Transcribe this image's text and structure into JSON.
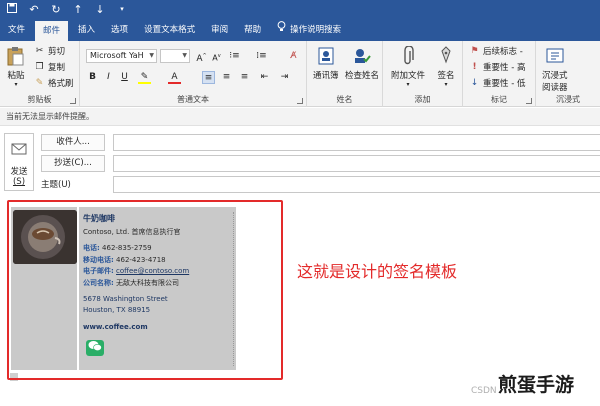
{
  "quick_access": {
    "icons": [
      "save-icon",
      "undo-icon",
      "redo-icon",
      "up-arrow-icon",
      "down-arrow-icon",
      "customize-icon"
    ]
  },
  "tabs": [
    {
      "label": "文件",
      "active": false
    },
    {
      "label": "邮件",
      "active": true
    },
    {
      "label": "插入",
      "active": false
    },
    {
      "label": "选项",
      "active": false
    },
    {
      "label": "设置文本格式",
      "active": false
    },
    {
      "label": "审阅",
      "active": false
    },
    {
      "label": "帮助",
      "active": false
    }
  ],
  "tell_me": {
    "label": "操作说明搜索",
    "icon": "lightbulb-icon"
  },
  "ribbon": {
    "clipboard": {
      "paste": "粘贴",
      "cut": "剪切",
      "copy": "复制",
      "format_painter": "格式刷",
      "group": "剪贴板"
    },
    "basic_text": {
      "font_name": "Microsoft YaH",
      "font_size": "",
      "group": "普通文本"
    },
    "names": {
      "address_book": "通讯簿",
      "check_names": "检查姓名",
      "group": "姓名"
    },
    "include": {
      "attach_file": "附加文件",
      "signature": "签名",
      "group": "添加"
    },
    "tags": {
      "follow_up": "后续标志 -",
      "high_importance": "重要性 - 高",
      "low_importance": "重要性 - 低",
      "group": "标记"
    },
    "immersive": {
      "reader_line1": "沉浸式",
      "reader_line2": "阅读器",
      "group": "沉浸式"
    }
  },
  "info_bar": "当前无法显示邮件提醒。",
  "compose": {
    "send": "发送",
    "send_key": "(S)",
    "to": "收件人...",
    "cc": "抄送(C)...",
    "subject": "主题(U)"
  },
  "signature": {
    "name": "牛奶咖啡",
    "company_title": "Contoso, Ltd. 首席信息执行官",
    "phone_label": "电话:",
    "phone": "462-835-2759",
    "mobile_label": "移动电话:",
    "mobile": "462-423-4718",
    "email_label": "电子邮件:",
    "email": "coffee@contoso.com",
    "company_label": "公司名称:",
    "company": "无敌大科技有限公司",
    "address1": "5678 Washington Street",
    "address2": "Houston, TX 88915",
    "website": "www.coffee.com",
    "social_icon": "wechat-icon"
  },
  "annotation": "这就是设计的签名模板",
  "watermarks": {
    "csdn": "CSDN",
    "brand": "煎蛋手游"
  },
  "colors": {
    "ribbon_blue": "#2b579a",
    "highlight_red": "#e32a2a"
  }
}
